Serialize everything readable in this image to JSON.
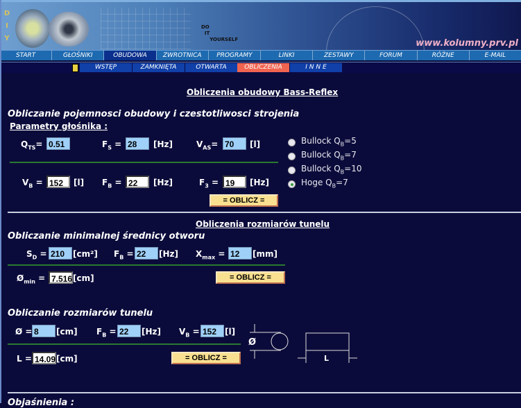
{
  "header": {
    "logo_letters": "DIY",
    "do_it_yourself": [
      "DO",
      "IT",
      "YOURSELF"
    ],
    "site_url": "www.kolumny.prv.pl"
  },
  "menu": [
    "START",
    "GŁOŚNIKI",
    "OBUDOWA",
    "ZWROTNICA",
    "PROGRAMY",
    "LINKI",
    "ZESTAWY",
    "FORUM",
    "RÓŻNE",
    "E-MAIL"
  ],
  "submenu": [
    "WSTĘP",
    "ZAMKNIĘTA",
    "OTWARTA",
    "OBLICZENIA",
    "I N N E"
  ],
  "page_title": "Obliczenia obudowy Bass-Reflex",
  "sec1": {
    "heading": "Obliczanie pojemnosci obudowy i czestotliwosci strojenia",
    "params_label": "Parametry głośnika :",
    "qts": {
      "label": "Q",
      "sub": "TS",
      "eq": "=",
      "value": "0.51"
    },
    "fs": {
      "label": "F",
      "sub": "S",
      "eq": " =",
      "value": "28",
      "unit": "[Hz]"
    },
    "vas": {
      "label": "V",
      "sub": "AS",
      "eq": "=",
      "value": "70",
      "unit": "[l]"
    },
    "vb": {
      "label": "V",
      "sub": "B",
      "eq": " =",
      "value": "152",
      "unit": "[l]"
    },
    "fb": {
      "label": "F",
      "sub": "B",
      "eq": " =",
      "value": "22",
      "unit": "[Hz]"
    },
    "f3": {
      "label": "F",
      "sub": "3",
      "eq": " =",
      "value": "19",
      "unit": "[Hz]"
    },
    "button": "= OBLICZ =",
    "options": [
      {
        "text": "Bullock Q",
        "sub": "B",
        "val": "=5",
        "selected": false
      },
      {
        "text": "Bullock Q",
        "sub": "B",
        "val": "=7",
        "selected": false
      },
      {
        "text": "Bullock Q",
        "sub": "B",
        "val": "=10",
        "selected": false
      },
      {
        "text": "Hoge Q",
        "sub": "B",
        "val": "=7",
        "selected": true
      }
    ]
  },
  "sec2_title": "Obliczenia rozmiarów tunelu",
  "sec2": {
    "heading": "Obliczanie minimalnej średnicy otworu",
    "sd": {
      "label": "S",
      "sub": "D",
      "eq": " =",
      "value": "210",
      "unit": "[cm²]"
    },
    "fb": {
      "label": "F",
      "sub": "B",
      "eq": " =",
      "value": "22",
      "unit": "[Hz]"
    },
    "xmax": {
      "label": "X",
      "sub": "max",
      "eq": " =",
      "value": "12",
      "unit": "[mm]"
    },
    "dmin": {
      "label": "Ø",
      "sub": "min",
      "eq": " =",
      "value": "7.516",
      "unit": "[cm]"
    },
    "button": "= OBLICZ ="
  },
  "sec3": {
    "heading": "Obliczanie rozmiarów tunelu",
    "d": {
      "label": "Ø =",
      "value": "8",
      "unit": "[cm]"
    },
    "fb": {
      "label": "F",
      "sub": "B",
      "eq": " =",
      "value": "22",
      "unit": "[Hz]"
    },
    "vb": {
      "label": "V",
      "sub": "B",
      "eq": " =",
      "value": "152",
      "unit": "[l]"
    },
    "l": {
      "label": "L =",
      "value": "14.09",
      "unit": "[cm]"
    },
    "button": "= OBLICZ =",
    "diagram_d": "Ø",
    "diagram_l": "L"
  },
  "footer_heading": "Objaśnienia :"
}
